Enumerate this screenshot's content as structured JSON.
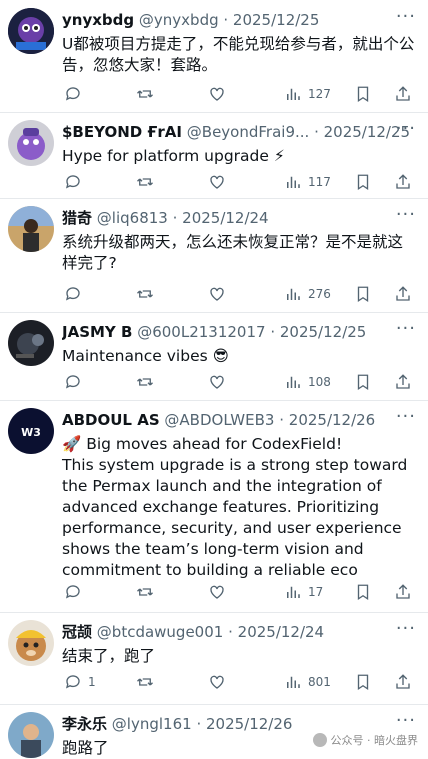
{
  "tweets": [
    {
      "name": "ynyxbdg",
      "handle": "@ynyxbdg",
      "date": "· 2025/12/25",
      "text": "U都被项目方提走了，不能兑现给参与者，就出个公告，忽悠大家！套路。",
      "replies": "",
      "retweets": "",
      "likes": "",
      "views": "127"
    },
    {
      "name": "$BEYOND ҒrAI",
      "handle": "@BeyondFrai9...",
      "date": "· 2025/12/25",
      "text": "Hype for platform upgrade ⚡",
      "replies": "",
      "retweets": "",
      "likes": "",
      "views": "117"
    },
    {
      "name": "猎奇",
      "handle": "@liq6813",
      "date": "· 2025/12/24",
      "text": "系统升级都两天，怎么还未恢复正常？是不是就这样完了?",
      "replies": "",
      "retweets": "",
      "likes": "",
      "views": "276"
    },
    {
      "name": "JASMY B",
      "handle": "@600L21312017",
      "date": "· 2025/12/25",
      "text": "Maintenance vibes 😎",
      "replies": "",
      "retweets": "",
      "likes": "",
      "views": "108"
    },
    {
      "name": "ABDOUL AS",
      "handle": "@ABDOLWEB3",
      "date": "· 2025/12/26",
      "text": "🚀 Big moves ahead for CodexField!\nThis system upgrade is a strong step toward the Permax launch and the integration of advanced exchange features. Prioritizing performance, security, and user experience shows the team’s long-term vision and commitment to building a reliable eco",
      "replies": "",
      "retweets": "",
      "likes": "",
      "views": "17"
    },
    {
      "name": "冠颉",
      "handle": "@btcdawuge001",
      "date": "· 2025/12/24",
      "text": "结束了，跑了",
      "replies": "1",
      "retweets": "",
      "likes": "",
      "views": "801"
    },
    {
      "name": "李永乐",
      "handle": "@lyngl161",
      "date": "· 2025/12/26",
      "text": "跑路了",
      "replies": "",
      "retweets": "",
      "likes": "",
      "views": ""
    }
  ],
  "more_label": "···",
  "watermark": "公众号 · 暗火盘界"
}
